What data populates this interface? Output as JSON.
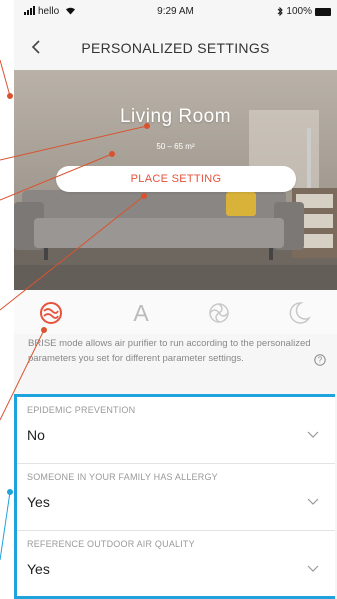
{
  "status_bar": {
    "carrier": "hello",
    "time": "9:29 AM",
    "battery": "100%"
  },
  "header": {
    "title": "PERSONALIZED SETTINGS"
  },
  "room": {
    "name": "Living Room",
    "size": "50 – 65 m²",
    "place_setting_label": "PLACE SETTING"
  },
  "modes": [
    {
      "icon": "brise-mode-icon",
      "active": true
    },
    {
      "label": "A",
      "icon": "auto-mode-icon",
      "active": false
    },
    {
      "icon": "swirl-mode-icon",
      "active": false
    },
    {
      "icon": "moon-mode-icon",
      "active": false
    }
  ],
  "description": "BRISE mode allows air purifier to run according to the personalized parameters you set for different parameter settings.",
  "settings": [
    {
      "label": "EPIDEMIC PREVENTION",
      "value": "No"
    },
    {
      "label": "SOMEONE IN YOUR FAMILY HAS ALLERGY",
      "value": "Yes"
    },
    {
      "label": "REFERENCE OUTDOOR AIR QUALITY",
      "value": "Yes"
    }
  ],
  "colors": {
    "accent": "#e7523a",
    "highlight": "#1fa3dc",
    "annotation": "#d9532f"
  }
}
